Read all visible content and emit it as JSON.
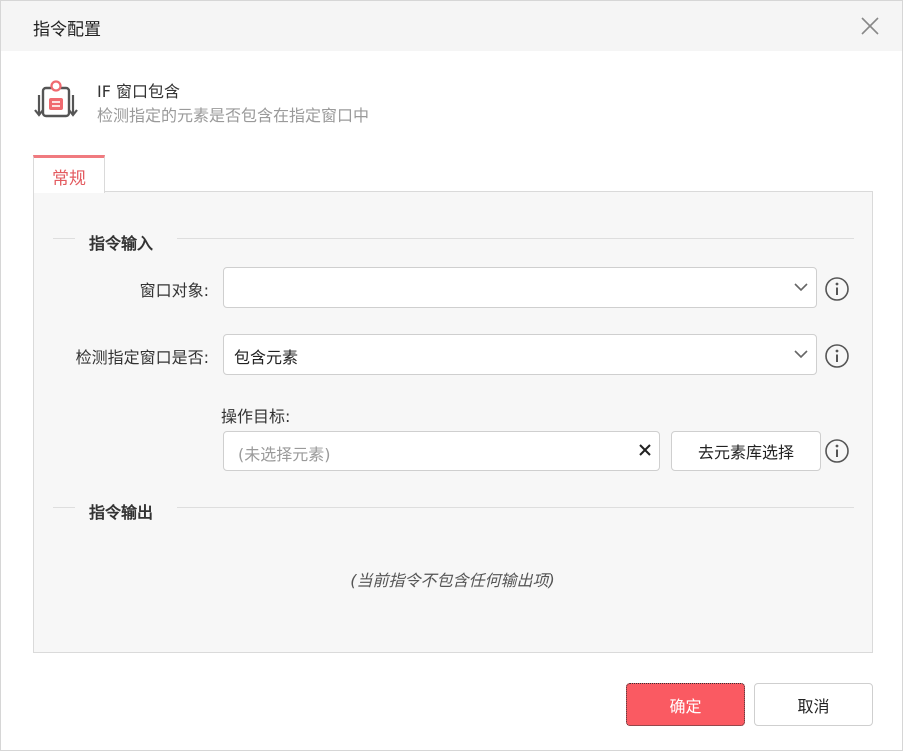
{
  "dialog": {
    "title": "指令配置",
    "close_icon": "close-icon"
  },
  "command": {
    "icon": "window-contains-icon",
    "name": "IF 窗口包含",
    "description": "检测指定的元素是否包含在指定窗口中"
  },
  "tabs": [
    {
      "label": "常规",
      "active": true
    }
  ],
  "sections": {
    "input_title": "指令输入",
    "output_title": "指令输出"
  },
  "fields": {
    "window_object": {
      "label": "窗口对象:",
      "value": ""
    },
    "detect_mode": {
      "label": "检测指定窗口是否:",
      "value": "包含元素"
    },
    "target": {
      "label": "操作目标:",
      "placeholder": "(未选择元素)",
      "library_button": "去元素库选择"
    }
  },
  "output_note": "(当前指令不包含任何输出项)",
  "footer": {
    "ok_label": "确定",
    "cancel_label": "取消"
  },
  "colors": {
    "accent": "#fa5a62",
    "tab_text": "#e35a5f"
  }
}
